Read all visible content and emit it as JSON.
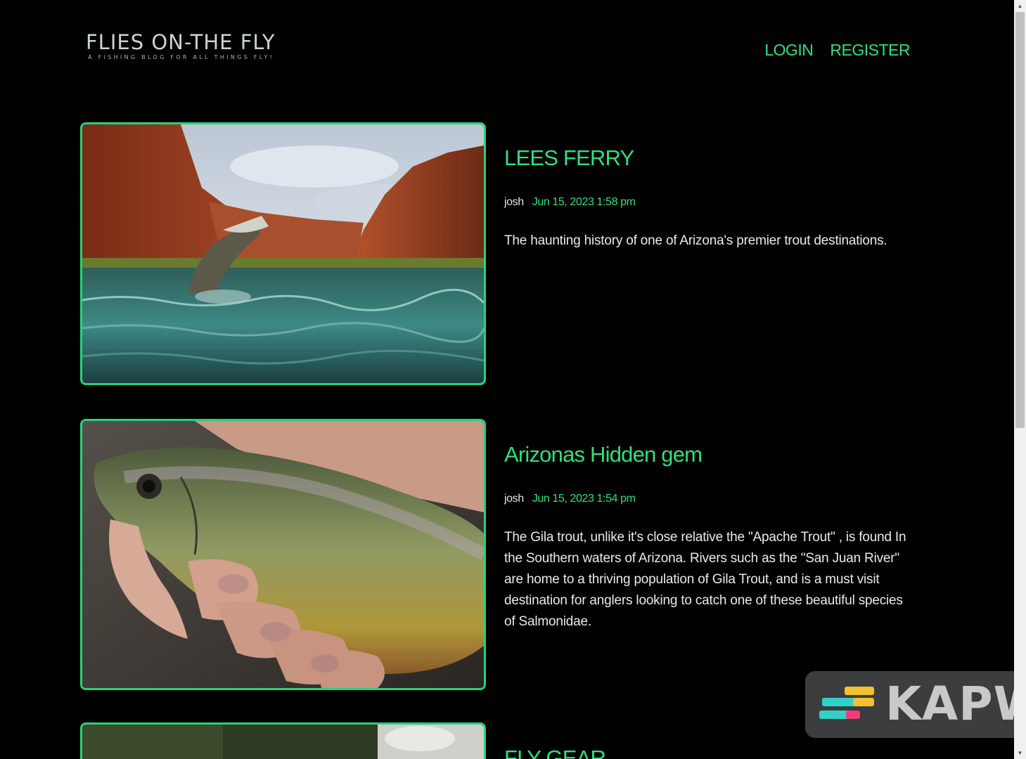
{
  "site": {
    "title": "FLIES ON-THE FLY",
    "tagline": "A FISHING BLOG FOR ALL THINGS FLY!"
  },
  "nav": {
    "login_label": "LOGIN",
    "register_label": "REGISTER"
  },
  "posts": [
    {
      "title": "LEES FERRY",
      "author": "josh",
      "date": "Jun 15, 2023 1:58 pm",
      "excerpt": "The haunting history of one of Arizona's premier trout destinations."
    },
    {
      "title": "Arizonas Hidden gem",
      "author": "josh",
      "date": "Jun 15, 2023 1:54 pm",
      "excerpt": "The Gila trout, unlike it's close relative the \"Apache Trout\" , is found In the Southern waters of Arizona. Rivers such as the \"San Juan River\" are home to a thriving population of Gila Trout, and is a must visit destination for anglers looking to catch one of these beautiful species of Salmonidae."
    },
    {
      "title": "FLY GEAR"
    }
  ],
  "watermark": {
    "text": "KAPW"
  },
  "colors": {
    "accent": "#2ee07e",
    "background": "#000000",
    "border": "#27d27a"
  }
}
